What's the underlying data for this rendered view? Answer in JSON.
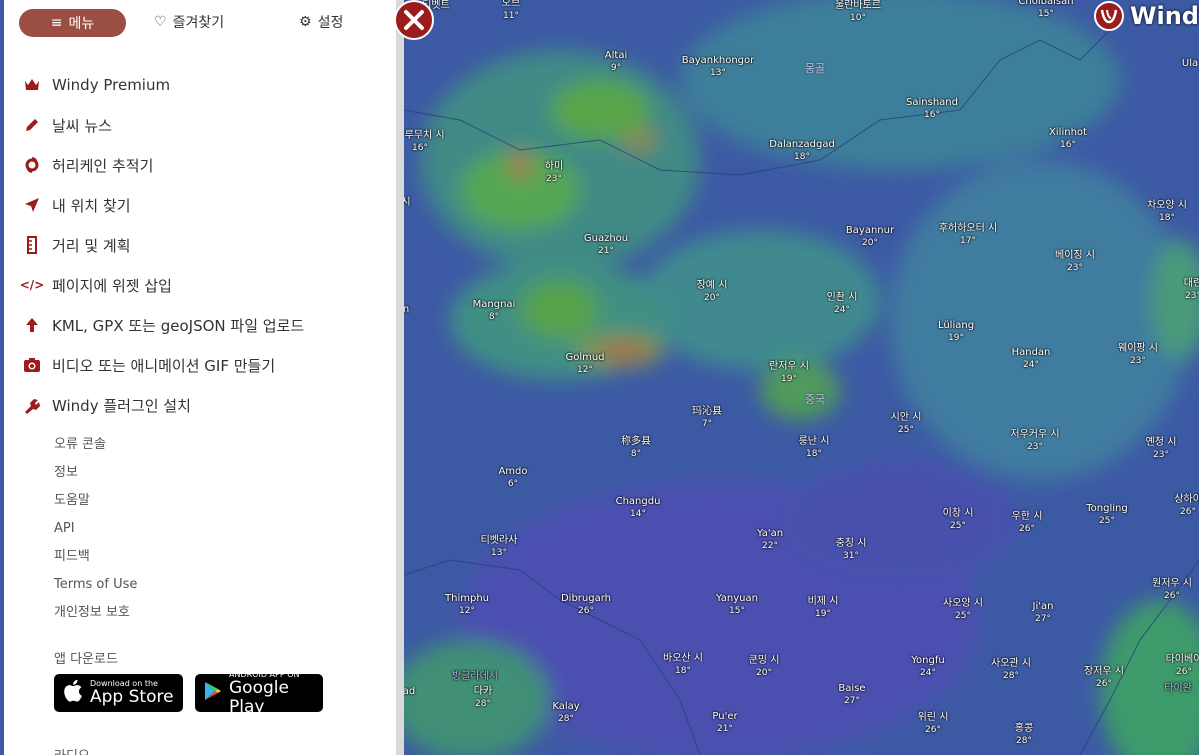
{
  "nav": {
    "menu_label": "메뉴",
    "favorites_label": "즐겨찾기",
    "settings_label": "설정"
  },
  "menu_items": [
    {
      "label": "Windy Premium",
      "icon": "crown-icon"
    },
    {
      "label": "날씨 뉴스",
      "icon": "pencil-icon"
    },
    {
      "label": "허리케인 추적기",
      "icon": "hurricane-icon"
    },
    {
      "label": "내 위치 찾기",
      "icon": "location-arrow-icon"
    },
    {
      "label": "거리 및 계획",
      "icon": "ruler-icon"
    },
    {
      "label": "페이지에 위젯 삽입",
      "icon": "code-icon"
    },
    {
      "label": "KML, GPX 또는 geoJSON 파일 업로드",
      "icon": "upload-arrow-icon"
    },
    {
      "label": "비디오 또는 애니메이션 GIF 만들기",
      "icon": "camera-icon"
    },
    {
      "label": "Windy 플러그인 설치",
      "icon": "plugin-icon"
    }
  ],
  "sub_items": [
    "오류 콘솔",
    "정보",
    "도움말",
    "API",
    "피드백",
    "Terms of Use",
    "개인정보 보호"
  ],
  "app_download": {
    "label": "앱 다운로드",
    "appstore_small": "Download on the",
    "appstore_big": "App Store",
    "play_small": "ANDROID APP ON",
    "play_big": "Google Play"
  },
  "bottom_partial": "라디오",
  "logo_text": "Windy",
  "colors": {
    "accent": "#9b4f42",
    "brand_red": "#9b1c1c"
  },
  "map": {
    "countries": [
      {
        "name": "몽골"
      },
      {
        "name": "중국"
      }
    ],
    "cities": [
      {
        "name": "티벳트",
        "temp": "",
        "partial": true
      },
      {
        "name": "오브",
        "temp": "11°"
      },
      {
        "name": "울란바토르",
        "temp": "10°"
      },
      {
        "name": "Choibalsan",
        "temp": "15°"
      },
      {
        "name": "Altai",
        "temp": "9°"
      },
      {
        "name": "Bayankhongor",
        "temp": "13°"
      },
      {
        "name": "Ula",
        "temp": ""
      },
      {
        "name": "Sainshand",
        "temp": "16°"
      },
      {
        "name": "우루무치 시",
        "temp": "16°"
      },
      {
        "name": "하미",
        "temp": "23°"
      },
      {
        "name": "Dalanzadgad",
        "temp": "18°"
      },
      {
        "name": "Xilinhot",
        "temp": "16°"
      },
      {
        "name": "차오양 시",
        "temp": "18°"
      },
      {
        "name": "Guazhou",
        "temp": "21°"
      },
      {
        "name": "Bayannur",
        "temp": "20°"
      },
      {
        "name": "후허하오터 시",
        "temp": "17°"
      },
      {
        "name": "베이징 시",
        "temp": "23°"
      },
      {
        "name": "대련",
        "temp": "23°"
      },
      {
        "name": "장예 시",
        "temp": "20°"
      },
      {
        "name": "인촨 시",
        "temp": "24°"
      },
      {
        "name": "Mangnai",
        "temp": "8°"
      },
      {
        "name": "Lüliang",
        "temp": "19°"
      },
      {
        "name": "Golmud",
        "temp": "12°"
      },
      {
        "name": "Handan",
        "temp": "24°"
      },
      {
        "name": "웨이팡 시",
        "temp": "23°"
      },
      {
        "name": "란저우 시",
        "temp": "19°"
      },
      {
        "name": "玛沁县",
        "temp": "7°"
      },
      {
        "name": "시안 시",
        "temp": "25°"
      },
      {
        "name": "称多县",
        "temp": "8°"
      },
      {
        "name": "룽난 시",
        "temp": "18°"
      },
      {
        "name": "저우커우 시",
        "temp": "23°"
      },
      {
        "name": "옌청 시",
        "temp": "23°"
      },
      {
        "name": "Amdo",
        "temp": "6°"
      },
      {
        "name": "상하이",
        "temp": "26°"
      },
      {
        "name": "Changdu",
        "temp": "14°"
      },
      {
        "name": "Tongling",
        "temp": "25°"
      },
      {
        "name": "이창 시",
        "temp": "25°"
      },
      {
        "name": "우한 시",
        "temp": "26°"
      },
      {
        "name": "티벳라사",
        "temp": "13°"
      },
      {
        "name": "Ya'an",
        "temp": "22°"
      },
      {
        "name": "충칭 시",
        "temp": "31°"
      },
      {
        "name": "원저우 시",
        "temp": "26°"
      },
      {
        "name": "Thimphu",
        "temp": "12°"
      },
      {
        "name": "Dibrugarh",
        "temp": "26°"
      },
      {
        "name": "Yanyuan",
        "temp": "15°"
      },
      {
        "name": "비제 시",
        "temp": "19°"
      },
      {
        "name": "사오양 시",
        "temp": "25°"
      },
      {
        "name": "Ji'an",
        "temp": "27°"
      },
      {
        "name": "바오산 시",
        "temp": "18°"
      },
      {
        "name": "쿤밍 시",
        "temp": "20°"
      },
      {
        "name": "Yongfu",
        "temp": "24°"
      },
      {
        "name": "사오관 시",
        "temp": "28°"
      },
      {
        "name": "장저우 시",
        "temp": "26°"
      },
      {
        "name": "타이베이",
        "temp": "26°"
      },
      {
        "name": "방글라데시",
        "temp": "",
        "dim": true
      },
      {
        "name": "다카",
        "temp": "28°"
      },
      {
        "name": "ad",
        "temp": "",
        "partial": true
      },
      {
        "name": "Kalay",
        "temp": "28°"
      },
      {
        "name": "Baise",
        "temp": "27°"
      },
      {
        "name": "Pu'er",
        "temp": "21°"
      },
      {
        "name": "위린 시",
        "temp": "26°"
      },
      {
        "name": "홍콩",
        "temp": "28°"
      },
      {
        "name": "n",
        "temp": "",
        "partial": true
      },
      {
        "name": "시",
        "temp": "",
        "partial": true
      },
      {
        "name": "타이완",
        "temp": "",
        "dim": true
      }
    ]
  }
}
